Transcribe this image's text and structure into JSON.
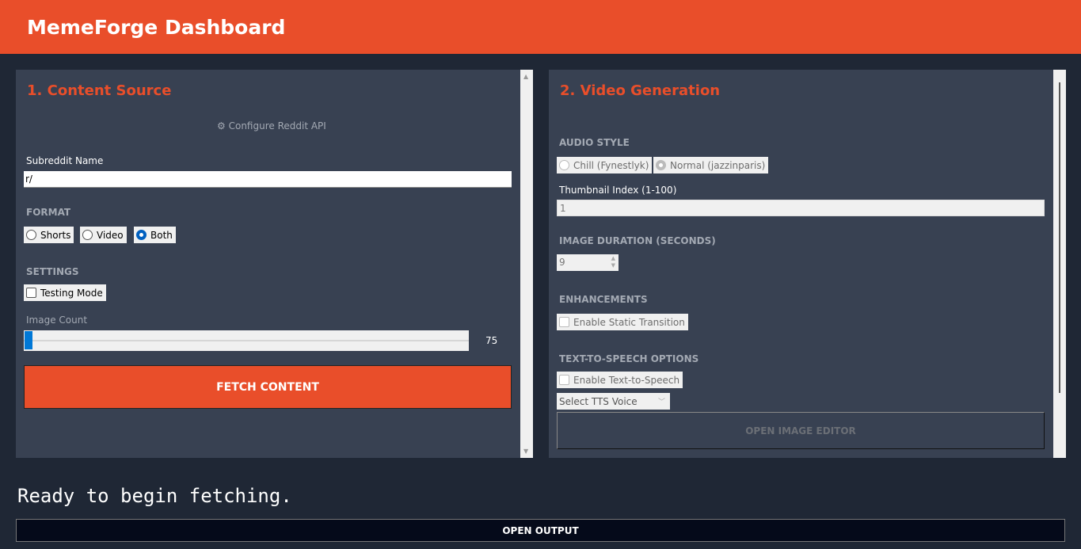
{
  "header": {
    "title": "MemeForge Dashboard"
  },
  "source": {
    "title": "1. Content Source",
    "configure_label": "Configure Reddit API",
    "configure_icon": "gear-icon",
    "subreddit_label": "Subreddit Name",
    "subreddit_value": "r/",
    "format_label": "FORMAT",
    "formats": [
      "Shorts",
      "Video",
      "Both"
    ],
    "format_selected": "Both",
    "settings_label": "SETTINGS",
    "testing_mode": "Testing Mode",
    "image_count_label": "Image Count",
    "image_count_value": "75",
    "fetch_label": "FETCH CONTENT"
  },
  "video": {
    "title": "2. Video Generation",
    "audio_label": "AUDIO STYLE",
    "audio_options": [
      "Chill (Fynestlyk)",
      "Normal (jazzinparis)"
    ],
    "thumb_label": "Thumbnail Index (1-100)",
    "thumb_value": "1",
    "duration_label": "IMAGE DURATION (SECONDS)",
    "duration_value": "9",
    "enh_label": "ENHANCEMENTS",
    "static_transition": "Enable Static Transition",
    "tts_label": "TEXT-TO-SPEECH OPTIONS",
    "tts_enable": "Enable Text-to-Speech",
    "tts_voice": "Select TTS Voice",
    "editor_label": "OPEN IMAGE EDITOR"
  },
  "status": {
    "text": "Ready to begin fetching."
  },
  "output": {
    "label": "OPEN OUTPUT"
  },
  "colors": {
    "accent": "#e94e2a",
    "panel": "#384152",
    "background": "#1f2735"
  }
}
